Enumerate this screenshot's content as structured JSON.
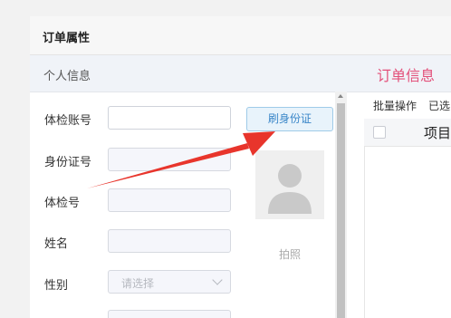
{
  "dialog": {
    "title": "订单属性"
  },
  "section": {
    "left_label": "个人信息",
    "right_label": "订单信息",
    "right_color": "#e3507a"
  },
  "form": {
    "fields": [
      {
        "label": "体检账号",
        "value": ""
      },
      {
        "label": "身份证号",
        "value": ""
      },
      {
        "label": "体检号",
        "value": ""
      },
      {
        "label": "姓名",
        "value": ""
      },
      {
        "label": "性别",
        "placeholder": "请选择"
      }
    ],
    "swipe_id_button": "刷身份证",
    "photo_label": "拍照"
  },
  "right_panel": {
    "batch_action": "批量操作",
    "selected_text": "已选",
    "column_project": "项目"
  },
  "annotation": {
    "arrow_color": "#e8352c"
  }
}
